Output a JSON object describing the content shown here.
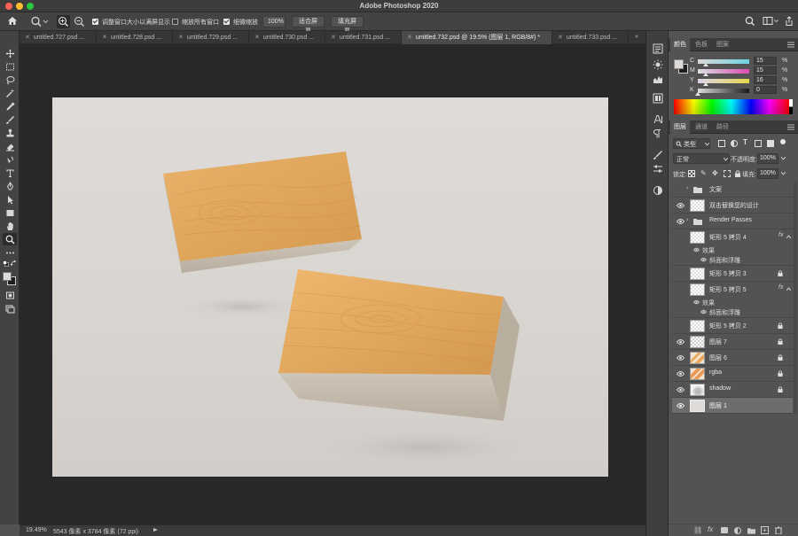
{
  "app": {
    "title": "Adobe Photoshop 2020"
  },
  "window_controls": {
    "close_color": "#fe5f57",
    "minimize_color": "#febc2e",
    "zoom_color": "#28c840"
  },
  "options_bar": {
    "resize_windows_label": "调整窗口大小以满屏显示",
    "resize_windows_checked": true,
    "zoom_all_label": "缩放所有窗口",
    "zoom_all_checked": false,
    "scrubby_zoom_label": "细微缩放",
    "scrubby_zoom_checked": true,
    "zoom_value": "100%",
    "fit_screen_label": "适合屏幕",
    "fill_screen_label": "填充屏幕"
  },
  "tabs": [
    {
      "label": "untitled.727.psd ...",
      "active": false
    },
    {
      "label": "untitled.728.psd ...",
      "active": false
    },
    {
      "label": "untitled.729.psd ...",
      "active": false
    },
    {
      "label": "untitled.730.psd ...",
      "active": false
    },
    {
      "label": "untitled.731.psd ...",
      "active": false
    },
    {
      "label": "untitled.732.psd @ 19.5% (图层 1, RGB/8#) *",
      "active": true
    },
    {
      "label": "untitled.733.psd ...",
      "active": false
    }
  ],
  "status": {
    "zoom": "19.49%",
    "doc_info": "5543 像素 x 3784 像素 (72 ppi)"
  },
  "color_panel": {
    "tabs": [
      "颜色",
      "色板",
      "图案"
    ],
    "channels": [
      {
        "label": "C",
        "value": "15",
        "unit": "%",
        "position": 0.15
      },
      {
        "label": "M",
        "value": "15",
        "unit": "%",
        "position": 0.15
      },
      {
        "label": "Y",
        "value": "16",
        "unit": "%",
        "position": 0.16
      },
      {
        "label": "K",
        "value": "0",
        "unit": "%",
        "position": 0.0
      }
    ],
    "foreground_color": "#dedbd8",
    "background_color": "#1e1e1e"
  },
  "layers_panel": {
    "tabs": [
      "图层",
      "通道",
      "路径"
    ],
    "filter_label": "类型",
    "blend_mode": "正常",
    "opacity_label": "不透明度:",
    "opacity_value": "100%",
    "lock_label": "锁定:",
    "fill_label": "填充:",
    "fill_value": "100%",
    "layers": [
      {
        "name": "文案",
        "kind": "group",
        "visible": false
      },
      {
        "name": "双击替换您的设计",
        "kind": "smart",
        "visible": true
      },
      {
        "name": "Render Passes",
        "kind": "group",
        "visible": true
      },
      {
        "name": "矩形 5 拷贝 4",
        "kind": "smart",
        "visible": false,
        "fx": "fx",
        "effects_label": "效果",
        "effect": "斜面和浮雕"
      },
      {
        "name": "矩形 5 拷贝 3",
        "kind": "smart",
        "visible": false,
        "locked": true
      },
      {
        "name": "矩形 5 拷贝 5",
        "kind": "smart",
        "visible": false,
        "fx": "fx",
        "effects_label": "效果",
        "effect": "斜面和浮雕"
      },
      {
        "name": "矩形 5 拷贝 2",
        "kind": "smart",
        "visible": false,
        "locked": true
      },
      {
        "name": "图层 7",
        "kind": "checker",
        "visible": true,
        "locked": true
      },
      {
        "name": "图层 6",
        "kind": "orange",
        "visible": true,
        "locked": true
      },
      {
        "name": "rgba",
        "kind": "rgba",
        "visible": true,
        "locked": true
      },
      {
        "name": "shadow",
        "kind": "shadow",
        "visible": true,
        "locked": true
      },
      {
        "name": "图层 1",
        "kind": "base",
        "visible": true,
        "selected": true
      }
    ]
  }
}
